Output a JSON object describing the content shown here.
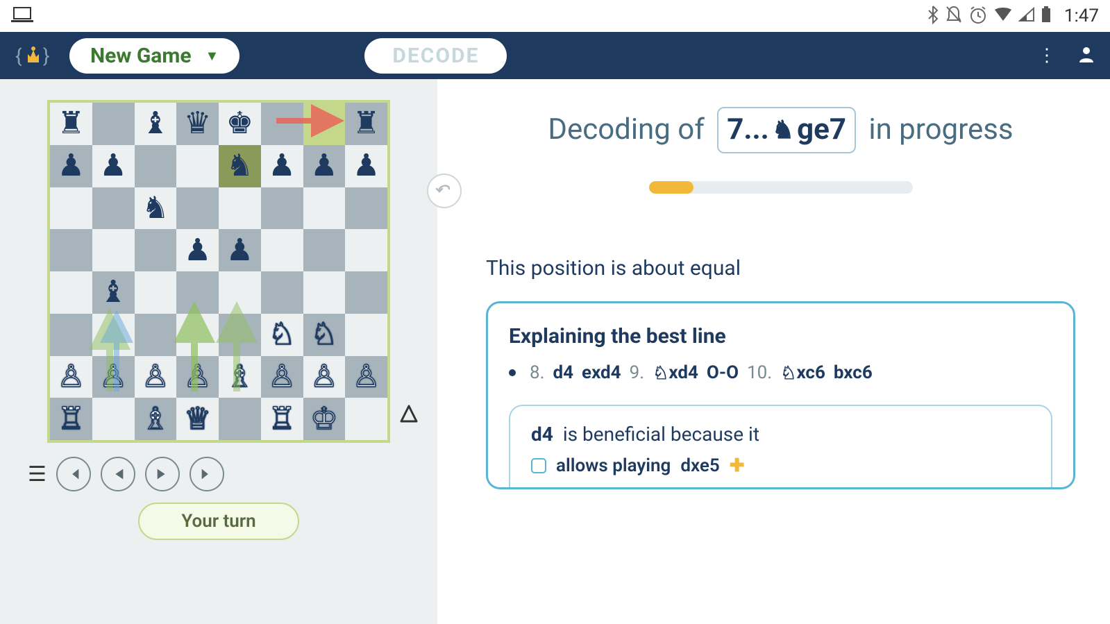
{
  "status": {
    "time": "1:47"
  },
  "appbar": {
    "new_game": "New Game",
    "decode": "DECODE"
  },
  "board": {
    "fen_rows": [
      "r.bqk..r",
      "pp..nppp",
      "..n.....",
      "...pp...",
      ".b......",
      ".....NN.",
      "PPPPBPPP",
      "R.BQ.RK."
    ],
    "highlights": {
      "from": "g8",
      "to": "e7"
    },
    "side_to_move_icon": "△"
  },
  "controls": {
    "turn_label": "Your turn"
  },
  "decoding": {
    "title_pre": "Decoding of",
    "move_prefix": "7...",
    "move_san": "ge7",
    "title_post": "in progress",
    "progress_pct": 17
  },
  "evaluation": "This position is about equal",
  "explain": {
    "title": "Explaining the best line",
    "line": [
      {
        "num": "8."
      },
      {
        "mv": "d4"
      },
      {
        "mv": "exd4"
      },
      {
        "num": "9."
      },
      {
        "knight": true,
        "mv": "xd4"
      },
      {
        "mv": "O-O"
      },
      {
        "num": "10."
      },
      {
        "knight": true,
        "mv": "xc6"
      },
      {
        "mv": "bxc6"
      }
    ],
    "sub": {
      "move": "d4",
      "text": "is beneficial because it",
      "reason_move": "dxe5",
      "reason_pre": "allows playing"
    }
  }
}
